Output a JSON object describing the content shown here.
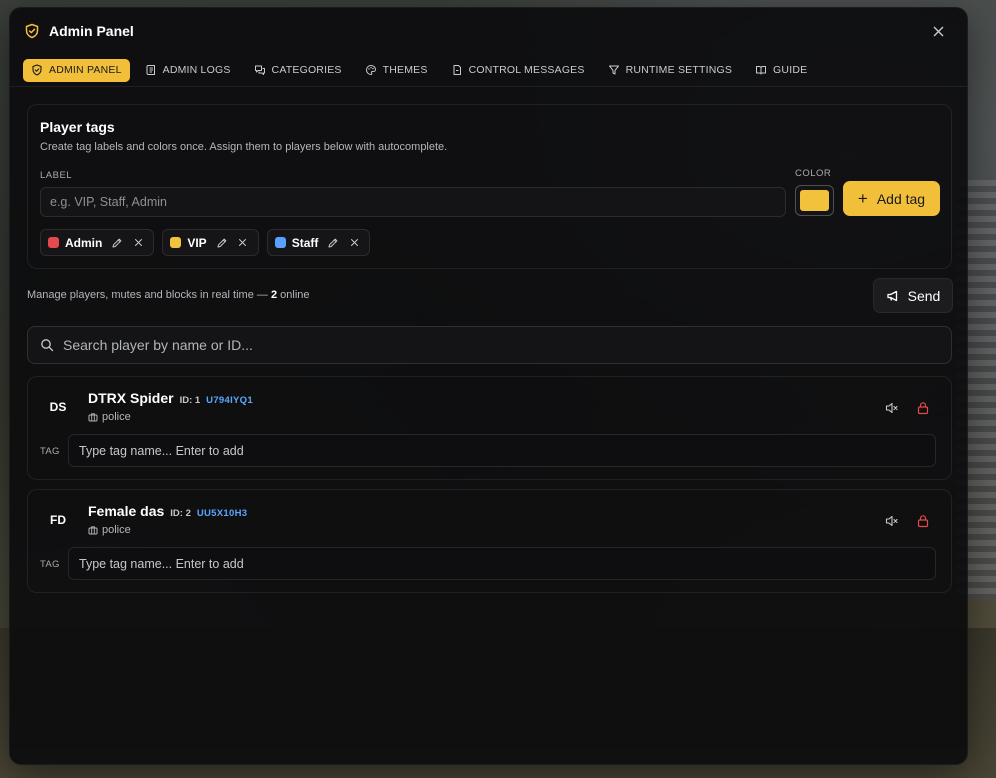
{
  "header": {
    "title": "Admin Panel",
    "close_icon": "close-icon"
  },
  "tabs": [
    {
      "label": "ADMIN PANEL",
      "icon": "shield-icon",
      "active": true
    },
    {
      "label": "ADMIN LOGS",
      "icon": "scroll-icon"
    },
    {
      "label": "CATEGORIES",
      "icon": "chat-bubbles-icon"
    },
    {
      "label": "THEMES",
      "icon": "palette-icon"
    },
    {
      "label": "CONTROL MESSAGES",
      "icon": "file-icon"
    },
    {
      "label": "RUNTIME SETTINGS",
      "icon": "filter-icon"
    },
    {
      "label": "GUIDE",
      "icon": "book-icon"
    }
  ],
  "tags_section": {
    "title": "Player tags",
    "description": "Create tag labels and colors once. Assign them to players below with autocomplete.",
    "label_field_label": "LABEL",
    "label_placeholder": "e.g. VIP, Staff, Admin",
    "color_field_label": "COLOR",
    "selected_color": "#f2c23c",
    "add_button": "Add tag",
    "tags": [
      {
        "name": "Admin",
        "color": "#e5484d"
      },
      {
        "name": "VIP",
        "color": "#f2c23c"
      },
      {
        "name": "Staff",
        "color": "#5aa0ff"
      }
    ]
  },
  "players_section": {
    "summary_prefix": "Manage players, mutes and blocks in real time — ",
    "online_count": "2",
    "summary_suffix": " online",
    "send_button": "Send",
    "search_placeholder": "Search player by name or ID...",
    "tag_label": "TAG",
    "tag_placeholder": "Type tag name... Enter to add",
    "players": [
      {
        "initials": "DS",
        "name": "DTRX Spider",
        "id": "ID: 1",
        "code": "U794IYQ1",
        "job": "police"
      },
      {
        "initials": "FD",
        "name": "Female das",
        "id": "ID: 2",
        "code": "UU5X10H3",
        "job": "police"
      }
    ]
  },
  "colors": {
    "accent": "#f2bf3a",
    "danger": "#e5484d",
    "link": "#5ba7ff"
  }
}
